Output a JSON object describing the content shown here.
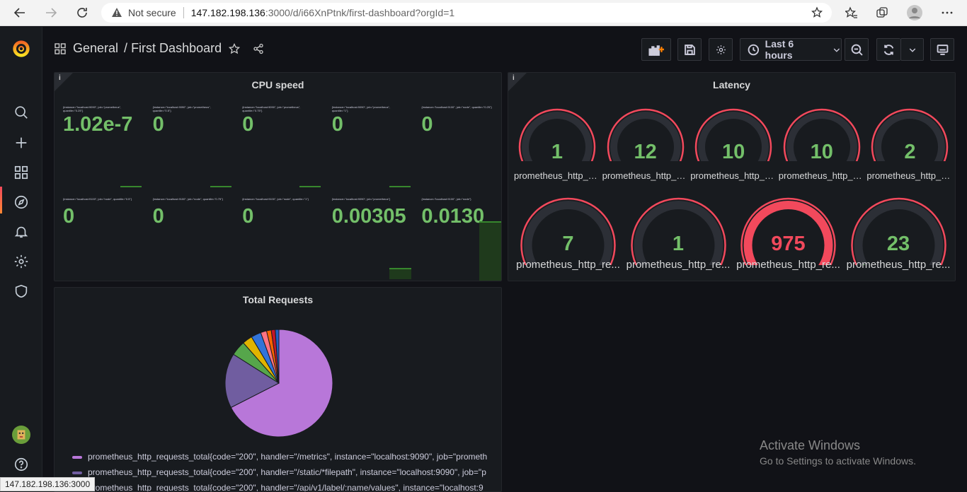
{
  "browser": {
    "security_label": "Not secure",
    "url_host": "147.182.198.136",
    "url_path": ":3000/d/i66XnPtnk/first-dashboard?orgId=1",
    "status_url": "147.182.198.136:3000"
  },
  "breadcrumb": {
    "folder": "General",
    "separator": "/",
    "title": "First Dashboard"
  },
  "toolbar": {
    "time_range": "Last 6 hours"
  },
  "panels": {
    "cpu": {
      "title": "CPU speed",
      "info": "i",
      "stats": [
        {
          "label": "{instance=\"localhost:9090\", job=\"prometheus\", quantile=\"0.25\"}",
          "value": "1.02e-7"
        },
        {
          "label": "{instance=\"localhost:9090\", job=\"prometheus\", quantile=\"0.5\"}",
          "value": "0"
        },
        {
          "label": "{instance=\"localhost:9090\", job=\"prometheus\", quantile=\"0.75\"}",
          "value": "0"
        },
        {
          "label": "{instance=\"localhost:9090\", job=\"prometheus\", quantile=\"1\"}",
          "value": "0"
        },
        {
          "label": "{instance=\"localhost:9100\", job=\"node\", quantile=\"0.25\"}",
          "value": "0"
        },
        {
          "label": "{instance=\"localhost:9100\", job=\"node\", quantile=\"0.5\"}",
          "value": "0"
        },
        {
          "label": "{instance=\"localhost:9100\", job=\"node\", quantile=\"0.75\"}",
          "value": "0"
        },
        {
          "label": "{instance=\"localhost:9100\", job=\"node\", quantile=\"1\"}",
          "value": "0"
        },
        {
          "label": "{instance=\"localhost:9090\", job=\"prometheus\"}",
          "value": "0.00305"
        },
        {
          "label": "{instance=\"localhost:9100\", job=\"node\"}",
          "value": "0.0130"
        }
      ]
    },
    "latency": {
      "title": "Latency",
      "info": "i",
      "gauges": [
        {
          "value": "1",
          "label": "prometheus_http_re...",
          "fill": 0.01
        },
        {
          "value": "12",
          "label": "prometheus_http_re...",
          "fill": 0.03
        },
        {
          "value": "10",
          "label": "prometheus_http_re...",
          "fill": 0.03
        },
        {
          "value": "10",
          "label": "prometheus_http_re...",
          "fill": 0.03
        },
        {
          "value": "2",
          "label": "prometheus_http_re...",
          "fill": 0.01
        },
        {
          "value": "7",
          "label": "prometheus_http_re...",
          "fill": 0.02
        },
        {
          "value": "1",
          "label": "prometheus_http_re...",
          "fill": 0.01
        },
        {
          "value": "975",
          "label": "prometheus_http_re...",
          "fill": 1.0
        },
        {
          "value": "23",
          "label": "prometheus_http_re...",
          "fill": 0.06
        }
      ]
    },
    "requests": {
      "title": "Total Requests",
      "legend": [
        {
          "text": "prometheus_http_requests_total{code=\"200\", handler=\"/metrics\", instance=\"localhost:9090\", job=\"prometh",
          "color": "#b877d9"
        },
        {
          "text": "prometheus_http_requests_total{code=\"200\", handler=\"/static/*filepath\", instance=\"localhost:9090\", job=\"p",
          "color": "#705da0"
        },
        {
          "text": "prometheus_http_requests_total{code=\"200\", handler=\"/api/v1/label/:name/values\", instance=\"localhost:9",
          "color": "#73bf69"
        }
      ]
    }
  },
  "chart_data": {
    "type": "pie",
    "title": "Total Requests",
    "slices": [
      {
        "value": 67.5,
        "color": "#b877d9"
      },
      {
        "value": 16.5,
        "color": "#705da0"
      },
      {
        "value": 4.5,
        "color": "#56a64b"
      },
      {
        "value": 3.0,
        "color": "#e0b400"
      },
      {
        "value": 3.0,
        "color": "#3274d9"
      },
      {
        "value": 1.8,
        "color": "#ff7383"
      },
      {
        "value": 1.4,
        "color": "#fa6400"
      },
      {
        "value": 1.2,
        "color": "#c4162a"
      },
      {
        "value": 1.1,
        "color": "#1f60c4"
      }
    ]
  },
  "watermark": {
    "line1": "Activate Windows",
    "line2": "Go to Settings to activate Windows."
  }
}
